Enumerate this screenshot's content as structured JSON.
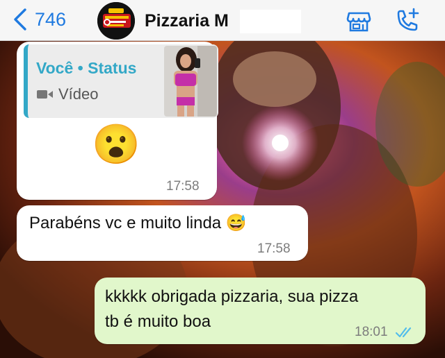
{
  "header": {
    "back_count": "746",
    "contact_name": "Pizzaria M"
  },
  "messages": [
    {
      "reply_author": "Você",
      "reply_separator": "•",
      "reply_source": "Status",
      "reply_media": "Vídeo",
      "emoji": "😮",
      "time": "17:58"
    },
    {
      "text": "Parabéns vc e muito linda 😅",
      "time": "17:58"
    },
    {
      "text_line1": "kkkkk obrigada pizzaria, sua pizza",
      "text_line2": "tb é muito boa",
      "time": "18:01",
      "status": "read"
    }
  ],
  "colors": {
    "accent": "#1f7ae0",
    "reply_accent": "#33a8c7",
    "outgoing_bubble": "#e1f7cb",
    "read_ticks": "#53bdeb"
  },
  "icons": [
    "chevron-left-icon",
    "store-icon",
    "add-call-icon",
    "video-camera-icon",
    "double-check-icon"
  ]
}
